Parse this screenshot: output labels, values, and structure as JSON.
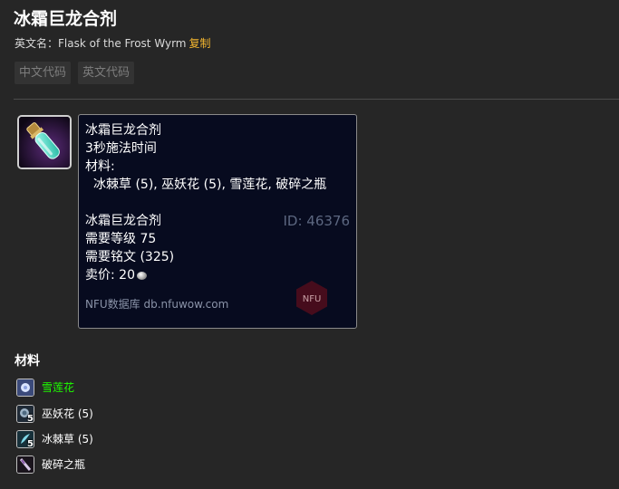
{
  "header": {
    "title": "冰霜巨龙合剂",
    "english_name_label": "英文名：",
    "english_name": "Flask of the Frost Wyrm",
    "copy_label": "复制"
  },
  "code_buttons": [
    "中文代码",
    "英文代码"
  ],
  "item_icon": "flask-of-frost-wyrm-icon",
  "tooltip": {
    "name": "冰霜巨龙合剂",
    "cast_time": "3秒施法时间",
    "reagents_label": "材料:",
    "reagents": "冰棘草 (5), 巫妖花 (5), 雪莲花, 破碎之瓶",
    "product_name": "冰霜巨龙合剂",
    "id": "ID: 46376",
    "level_req": "需要等级 75",
    "skill_req": "需要铭文 (325)",
    "sell_price_label": "卖价: 20",
    "currency_icon": "silver-coin-icon",
    "footer": "NFU数据库 db.nfuwow.com",
    "watermark": "NFU"
  },
  "materials": {
    "heading": "材料",
    "items": [
      {
        "name": "雪莲花",
        "count": "",
        "quality_color": "#1eff00",
        "icon": "frost-lotus-icon"
      },
      {
        "name": "巫妖花 (5)",
        "count": "5",
        "quality_color": "#ffffff",
        "icon": "lichbloom-icon"
      },
      {
        "name": "冰棘草 (5)",
        "count": "5",
        "quality_color": "#ffffff",
        "icon": "icethorn-icon"
      },
      {
        "name": "破碎之瓶",
        "count": "",
        "quality_color": "#ffffff",
        "icon": "shattered-vial-icon"
      }
    ]
  }
}
